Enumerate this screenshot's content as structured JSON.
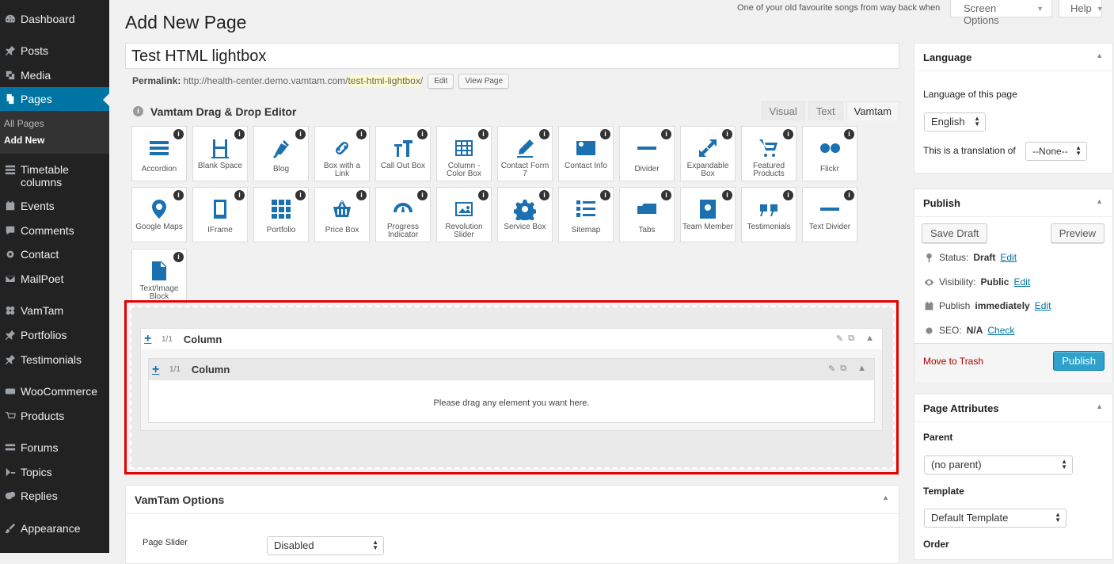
{
  "sidebar": {
    "items": [
      {
        "label": "Dashboard",
        "icon": "dashboard-icon"
      },
      {
        "label": "Posts",
        "icon": "pin-icon"
      },
      {
        "label": "Media",
        "icon": "media-icon"
      },
      {
        "label": "Pages",
        "icon": "pages-icon"
      },
      {
        "label": "Timetable columns",
        "icon": "grid-icon"
      },
      {
        "label": "Events",
        "icon": "calendar-icon"
      },
      {
        "label": "Comments",
        "icon": "comment-icon"
      },
      {
        "label": "Contact",
        "icon": "gear-icon"
      },
      {
        "label": "MailPoet",
        "icon": "mail-icon"
      },
      {
        "label": "VamTam",
        "icon": "vamtam-icon"
      },
      {
        "label": "Portfolios",
        "icon": "pin-icon"
      },
      {
        "label": "Testimonials",
        "icon": "pin-icon"
      },
      {
        "label": "WooCommerce",
        "icon": "woocommerce-icon"
      },
      {
        "label": "Products",
        "icon": "products-icon"
      },
      {
        "label": "Forums",
        "icon": "forums-icon"
      },
      {
        "label": "Topics",
        "icon": "topics-icon"
      },
      {
        "label": "Replies",
        "icon": "replies-icon"
      },
      {
        "label": "Appearance",
        "icon": "brush-icon"
      }
    ],
    "pages_sub": [
      "All Pages",
      "Add New"
    ]
  },
  "topbar": {
    "dolly": "One of your old favourite songs from way back when",
    "screen_options": "Screen Options",
    "help": "Help"
  },
  "editor": {
    "page_title": "Add New Page",
    "title_value": "Test HTML lightbox",
    "permalink_label": "Permalink:",
    "permalink_base": "http://health-center.demo.vamtam.com/",
    "permalink_slug": "test-html-lightbox",
    "permalink_end": "/",
    "edit_btn": "Edit",
    "view_btn": "View Page",
    "dnd_title": "Vamtam Drag & Drop Editor",
    "tabs": [
      "Visual",
      "Text",
      "Vamtam"
    ]
  },
  "shortcodes": [
    "Accordion",
    "Blank Space",
    "Blog",
    "Box with a Link",
    "Call Out Box",
    "Column - Color Box",
    "Contact Form 7",
    "Contact Info",
    "Divider",
    "Expandable Box",
    "Featured Products",
    "Flickr",
    "Google Maps",
    "IFrame",
    "Portfolio",
    "Price Box",
    "Progress Indicator",
    "Revolution Slider",
    "Service Box",
    "Sitemap",
    "Tabs",
    "Team Member",
    "Testimonials",
    "Text Divider",
    "Text/Image Block"
  ],
  "layout_area": {
    "outer_fraction": "1/1",
    "outer_title": "Column",
    "inner_fraction": "1/1",
    "inner_title": "Column",
    "placeholder": "Please drag any element you want here.",
    "highlight_color": "#e60000"
  },
  "options": {
    "title": "VamTam Options",
    "slider_label": "Page Slider",
    "slider_value": "Disabled"
  },
  "language_box": {
    "title": "Language",
    "lang_label": "Language of this page",
    "lang_value": "English",
    "translation_label": "This is a translation of",
    "translation_value": "--None--"
  },
  "publish_box": {
    "title": "Publish",
    "save_draft": "Save Draft",
    "preview": "Preview",
    "status_label": "Status:",
    "status_value": "Draft",
    "visibility_label": "Visibility:",
    "visibility_value": "Public",
    "publish_label": "Publish",
    "publish_value": "immediately",
    "seo_label": "SEO:",
    "seo_value": "N/A",
    "edit_link": "Edit",
    "check_link": "Check",
    "trash": "Move to Trash",
    "publish_btn": "Publish"
  },
  "attributes_box": {
    "title": "Page Attributes",
    "parent_label": "Parent",
    "parent_value": "(no parent)",
    "template_label": "Template",
    "template_value": "Default Template",
    "order_label": "Order"
  },
  "colors": {
    "accent": "#0074a2",
    "icon_blue": "#1b70b0",
    "sidebar_bg": "#222222"
  }
}
